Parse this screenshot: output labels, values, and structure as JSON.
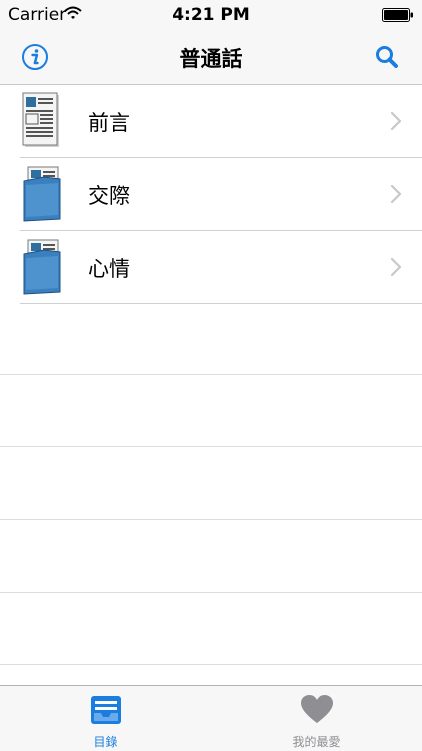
{
  "status_bar": {
    "carrier": "Carrier",
    "time": "4:21 PM"
  },
  "nav": {
    "title": "普通話",
    "left_icon": "info-icon",
    "right_icon": "search-icon"
  },
  "list": {
    "items": [
      {
        "label": "前言",
        "icon": "document-icon"
      },
      {
        "label": "交際",
        "icon": "blue-folder-icon"
      },
      {
        "label": "心情",
        "icon": "blue-folder-icon"
      }
    ]
  },
  "tabs": [
    {
      "label": "目錄",
      "icon": "tray-icon",
      "selected": true
    },
    {
      "label": "我的最愛",
      "icon": "heart-icon",
      "selected": false
    }
  ],
  "colors": {
    "accent": "#1a7de0",
    "inactive": "#8e8e93",
    "bar_background": "#f7f7f7"
  }
}
